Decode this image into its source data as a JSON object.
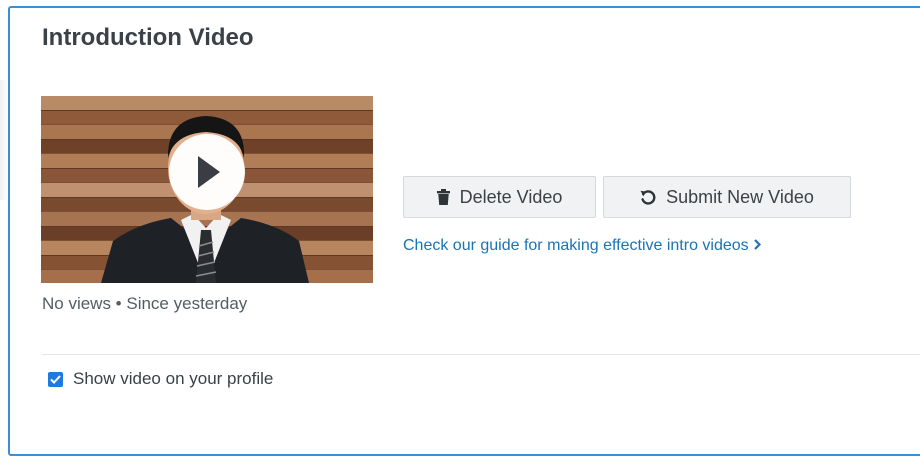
{
  "section": {
    "title": "Introduction Video"
  },
  "video": {
    "stats_text": "No views • Since yesterday",
    "play_icon": "play-icon"
  },
  "actions": {
    "delete_label": "Delete Video",
    "delete_icon": "trash-icon",
    "submit_label": "Submit New Video",
    "submit_icon": "refresh-icon"
  },
  "guide_link": {
    "text": "Check our guide for making effective intro videos",
    "icon": "chevron-right-icon"
  },
  "profile_toggle": {
    "label": "Show video on your profile",
    "checked": true
  },
  "colors": {
    "border": "#3a8fd6",
    "link": "#1a73b3",
    "checkbox": "#1f7ae0",
    "text": "#3a4247"
  }
}
